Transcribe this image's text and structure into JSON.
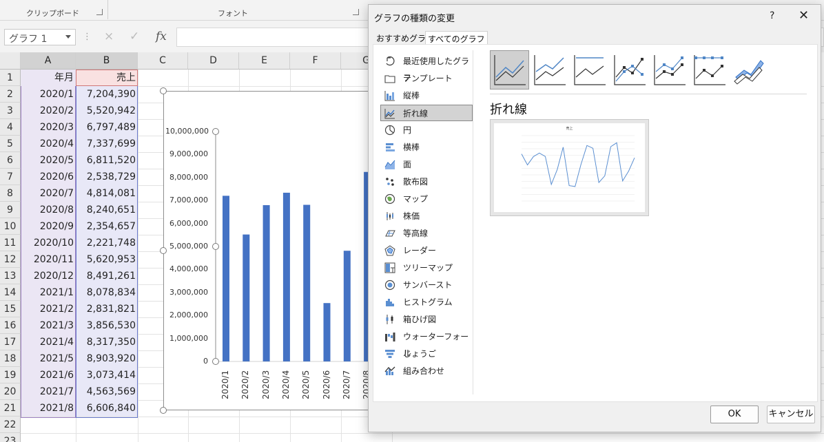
{
  "ribbon": {
    "group_clipboard": "クリップボード",
    "group_font": "フォント"
  },
  "formula_bar": {
    "name_box": "グラフ 1",
    "cancel_icon": "×",
    "enter_icon": "✓",
    "fx_label": "fx"
  },
  "sheet": {
    "columns": [
      "A",
      "B",
      "C",
      "D",
      "E",
      "F",
      "G"
    ],
    "row_numbers": [
      "1",
      "2",
      "3",
      "4",
      "5",
      "6",
      "7",
      "8",
      "9",
      "10",
      "11",
      "12",
      "13",
      "14",
      "15",
      "16",
      "17",
      "18",
      "19",
      "20",
      "21",
      "22",
      "23"
    ],
    "header": {
      "a": "年月",
      "b": "売上"
    },
    "rows": [
      {
        "a": "2020/1",
        "b": "7,204,390"
      },
      {
        "a": "2020/2",
        "b": "5,520,942"
      },
      {
        "a": "2020/3",
        "b": "6,797,489"
      },
      {
        "a": "2020/4",
        "b": "7,337,699"
      },
      {
        "a": "2020/5",
        "b": "6,811,520"
      },
      {
        "a": "2020/6",
        "b": "2,538,729"
      },
      {
        "a": "2020/7",
        "b": "4,814,081"
      },
      {
        "a": "2020/8",
        "b": "8,240,651"
      },
      {
        "a": "2020/9",
        "b": "2,354,657"
      },
      {
        "a": "2020/10",
        "b": "2,221,748"
      },
      {
        "a": "2020/11",
        "b": "5,620,953"
      },
      {
        "a": "2020/12",
        "b": "8,491,261"
      },
      {
        "a": "2021/1",
        "b": "8,078,834"
      },
      {
        "a": "2021/2",
        "b": "2,831,821"
      },
      {
        "a": "2021/3",
        "b": "3,856,530"
      },
      {
        "a": "2021/4",
        "b": "8,317,350"
      },
      {
        "a": "2021/5",
        "b": "8,903,920"
      },
      {
        "a": "2021/6",
        "b": "3,073,414"
      },
      {
        "a": "2021/7",
        "b": "4,563,569"
      },
      {
        "a": "2021/8",
        "b": "6,606,840"
      }
    ]
  },
  "chart_data": {
    "type": "bar",
    "categories": [
      "2020/1",
      "2020/2",
      "2020/3",
      "2020/4",
      "2020/5",
      "2020/6",
      "2020/7",
      "2020/8"
    ],
    "values": [
      7204390,
      5520942,
      6797489,
      7337699,
      6811520,
      2538729,
      4814081,
      8240651
    ],
    "ylim": [
      0,
      10000000
    ],
    "yticks": [
      "0",
      "1,000,000",
      "2,000,000",
      "3,000,000",
      "4,000,000",
      "5,000,000",
      "6,000,000",
      "7,000,000",
      "8,000,000",
      "9,000,000",
      "10,000,000"
    ],
    "bar_color": "#4472c4",
    "title": "",
    "xlabel": "",
    "ylabel": ""
  },
  "dialog": {
    "title": "グラフの種類の変更",
    "help": "?",
    "close": "✕",
    "tabs": [
      "おすすめグラフ",
      "すべてのグラフ"
    ],
    "chart_types": [
      {
        "label": "最近使用したグラフ",
        "icon": "recent-icon"
      },
      {
        "label": "テンプレート",
        "icon": "template-folder-icon"
      },
      {
        "label": "縦棒",
        "icon": "column-chart-icon"
      },
      {
        "label": "折れ線",
        "icon": "line-chart-icon"
      },
      {
        "label": "円",
        "icon": "pie-chart-icon"
      },
      {
        "label": "横棒",
        "icon": "bar-chart-icon"
      },
      {
        "label": "面",
        "icon": "area-chart-icon"
      },
      {
        "label": "散布図",
        "icon": "scatter-chart-icon"
      },
      {
        "label": "マップ",
        "icon": "map-chart-icon"
      },
      {
        "label": "株価",
        "icon": "stock-chart-icon"
      },
      {
        "label": "等高線",
        "icon": "surface-chart-icon"
      },
      {
        "label": "レーダー",
        "icon": "radar-chart-icon"
      },
      {
        "label": "ツリーマップ",
        "icon": "treemap-chart-icon"
      },
      {
        "label": "サンバースト",
        "icon": "sunburst-chart-icon"
      },
      {
        "label": "ヒストグラム",
        "icon": "histogram-chart-icon"
      },
      {
        "label": "箱ひげ図",
        "icon": "boxwhisker-chart-icon"
      },
      {
        "label": "ウォーターフォール",
        "icon": "waterfall-chart-icon"
      },
      {
        "label": "じょうご",
        "icon": "funnel-chart-icon"
      },
      {
        "label": "組み合わせ",
        "icon": "combo-chart-icon"
      }
    ],
    "selected_type": "折れ線",
    "subtype_heading": "折れ線",
    "preview_title": "売上",
    "ok": "OK",
    "cancel": "キャンセル"
  }
}
